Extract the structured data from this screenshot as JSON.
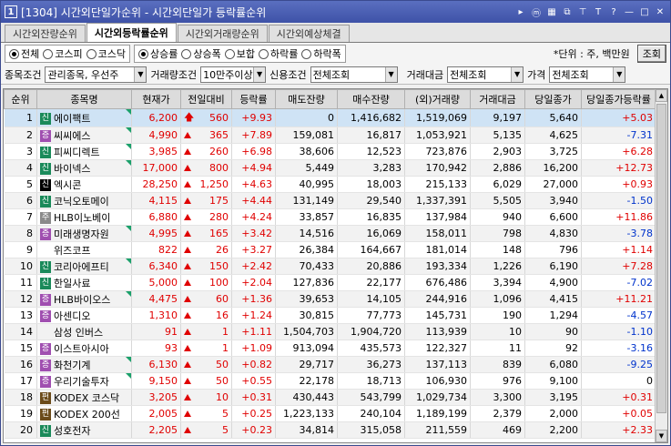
{
  "window": {
    "number": "1",
    "title": "[1304] 시간외단일가순위 - 시간외단일가 등락률순위"
  },
  "tabs": [
    {
      "label": "시간외잔량순위",
      "active": false
    },
    {
      "label": "시간외등락률순위",
      "active": true
    },
    {
      "label": "시간외거래량순위",
      "active": false
    },
    {
      "label": "시간외예상체결",
      "active": false
    }
  ],
  "market_filter": {
    "options": [
      "전체",
      "코스피",
      "코스닥"
    ],
    "selected": "전체"
  },
  "direction_filter": {
    "options": [
      "상승률",
      "상승폭",
      "보합",
      "하락률",
      "하락폭"
    ],
    "selected": "상승률"
  },
  "unit_text": "*단위 : 주, 백만원",
  "lookup_button": "조회",
  "conditions": {
    "item_label": "종목조건",
    "item_value": "관리종목, 우선주",
    "volume_label": "거래량조건",
    "volume_value": "10만주이상",
    "credit_label": "신용조건",
    "credit_value": "전체조회",
    "amount_label": "거래대금",
    "amount_value": "전체조회",
    "price_label": "가격",
    "price_value": "전체조회"
  },
  "table": {
    "headers": [
      "순위",
      "종목명",
      "현재가",
      "전일대비",
      "등락률",
      "매도잔량",
      "매수잔량",
      "(외)거래량",
      "거래대금",
      "당일종가",
      "당일종가등락률"
    ],
    "rows": [
      {
        "rank": "1",
        "badge": "신",
        "btype": "sin",
        "name": "에이팩트",
        "price": "6,200",
        "diff": "560",
        "marker": "arrow",
        "rate": "+9.93",
        "sell": "0",
        "buy": "1,416,682",
        "volume": "1,519,069",
        "amount": "9,197",
        "close": "5,640",
        "close_rate": "+5.03",
        "cr_dir": "up",
        "corner": true
      },
      {
        "rank": "2",
        "badge": "증",
        "btype": "jeung",
        "name": "씨씨에스",
        "price": "4,990",
        "diff": "365",
        "marker": "tri",
        "rate": "+7.89",
        "sell": "159,081",
        "buy": "16,817",
        "volume": "1,053,921",
        "amount": "5,135",
        "close": "4,625",
        "close_rate": "-7.31",
        "cr_dir": "down",
        "corner": true
      },
      {
        "rank": "3",
        "badge": "신",
        "btype": "sin",
        "name": "피씨디렉트",
        "price": "3,985",
        "diff": "260",
        "marker": "tri",
        "rate": "+6.98",
        "sell": "38,606",
        "buy": "12,523",
        "volume": "723,876",
        "amount": "2,903",
        "close": "3,725",
        "close_rate": "+6.28",
        "cr_dir": "up",
        "corner": true
      },
      {
        "rank": "4",
        "badge": "신",
        "btype": "sin",
        "name": "바이넥스",
        "price": "17,000",
        "diff": "800",
        "marker": "tri",
        "rate": "+4.94",
        "sell": "5,449",
        "buy": "3,283",
        "volume": "170,942",
        "amount": "2,886",
        "close": "16,200",
        "close_rate": "+12.73",
        "cr_dir": "up",
        "corner": true
      },
      {
        "rank": "5",
        "badge": "신",
        "btype": "sin-dark",
        "name": "엑시콘",
        "price": "28,250",
        "diff": "1,250",
        "marker": "tri",
        "rate": "+4.63",
        "sell": "40,995",
        "buy": "18,003",
        "volume": "215,133",
        "amount": "6,029",
        "close": "27,000",
        "close_rate": "+0.93",
        "cr_dir": "up",
        "corner": false
      },
      {
        "rank": "6",
        "badge": "신",
        "btype": "sin",
        "name": "코닉오토메이",
        "price": "4,115",
        "diff": "175",
        "marker": "tri",
        "rate": "+4.44",
        "sell": "131,149",
        "buy": "29,540",
        "volume": "1,337,391",
        "amount": "5,505",
        "close": "3,940",
        "close_rate": "-1.50",
        "cr_dir": "down",
        "corner": false
      },
      {
        "rank": "7",
        "badge": "주",
        "btype": "ju",
        "name": "HLB이노베이",
        "price": "6,880",
        "diff": "280",
        "marker": "tri",
        "rate": "+4.24",
        "sell": "33,857",
        "buy": "16,835",
        "volume": "137,984",
        "amount": "940",
        "close": "6,600",
        "close_rate": "+11.86",
        "cr_dir": "up",
        "corner": false
      },
      {
        "rank": "8",
        "badge": "증",
        "btype": "jeung",
        "name": "미래생명자원",
        "price": "4,995",
        "diff": "165",
        "marker": "tri",
        "rate": "+3.42",
        "sell": "14,516",
        "buy": "16,069",
        "volume": "158,011",
        "amount": "798",
        "close": "4,830",
        "close_rate": "-3.78",
        "cr_dir": "down",
        "corner": true
      },
      {
        "rank": "9",
        "badge": "",
        "btype": "",
        "name": "위즈코프",
        "price": "822",
        "diff": "26",
        "marker": "tri",
        "rate": "+3.27",
        "sell": "26,384",
        "buy": "164,667",
        "volume": "181,014",
        "amount": "148",
        "close": "796",
        "close_rate": "+1.14",
        "cr_dir": "up",
        "corner": false
      },
      {
        "rank": "10",
        "badge": "신",
        "btype": "sin",
        "name": "코리아에프티",
        "price": "6,340",
        "diff": "150",
        "marker": "tri",
        "rate": "+2.42",
        "sell": "70,433",
        "buy": "20,886",
        "volume": "193,334",
        "amount": "1,226",
        "close": "6,190",
        "close_rate": "+7.28",
        "cr_dir": "up",
        "corner": true
      },
      {
        "rank": "11",
        "badge": "신",
        "btype": "sin",
        "name": "한일사료",
        "price": "5,000",
        "diff": "100",
        "marker": "tri",
        "rate": "+2.04",
        "sell": "127,836",
        "buy": "22,177",
        "volume": "676,486",
        "amount": "3,394",
        "close": "4,900",
        "close_rate": "-7.02",
        "cr_dir": "down",
        "corner": false
      },
      {
        "rank": "12",
        "badge": "증",
        "btype": "jeung",
        "name": "HLB바이오스",
        "price": "4,475",
        "diff": "60",
        "marker": "tri",
        "rate": "+1.36",
        "sell": "39,653",
        "buy": "14,105",
        "volume": "244,916",
        "amount": "1,096",
        "close": "4,415",
        "close_rate": "+11.21",
        "cr_dir": "up",
        "corner": true
      },
      {
        "rank": "13",
        "badge": "증",
        "btype": "jeung",
        "name": "아센디오",
        "price": "1,310",
        "diff": "16",
        "marker": "tri",
        "rate": "+1.24",
        "sell": "30,815",
        "buy": "77,773",
        "volume": "145,731",
        "amount": "190",
        "close": "1,294",
        "close_rate": "-4.57",
        "cr_dir": "down",
        "corner": false
      },
      {
        "rank": "14",
        "badge": "",
        "btype": "",
        "name": "삼성 인버스",
        "price": "91",
        "diff": "1",
        "marker": "tri",
        "rate": "+1.11",
        "sell": "1,504,703",
        "buy": "1,904,720",
        "volume": "113,939",
        "amount": "10",
        "close": "90",
        "close_rate": "-1.10",
        "cr_dir": "down",
        "corner": false
      },
      {
        "rank": "15",
        "badge": "증",
        "btype": "jeung",
        "name": "이스트아시아",
        "price": "93",
        "diff": "1",
        "marker": "tri",
        "rate": "+1.09",
        "sell": "913,094",
        "buy": "435,573",
        "volume": "122,327",
        "amount": "11",
        "close": "92",
        "close_rate": "-3.16",
        "cr_dir": "down",
        "corner": false
      },
      {
        "rank": "16",
        "badge": "증",
        "btype": "jeung",
        "name": "화천기계",
        "price": "6,130",
        "diff": "50",
        "marker": "tri",
        "rate": "+0.82",
        "sell": "29,717",
        "buy": "36,273",
        "volume": "137,113",
        "amount": "839",
        "close": "6,080",
        "close_rate": "-9.25",
        "cr_dir": "down",
        "corner": true
      },
      {
        "rank": "17",
        "badge": "증",
        "btype": "jeung",
        "name": "우리기술투자",
        "price": "9,150",
        "diff": "50",
        "marker": "tri",
        "rate": "+0.55",
        "sell": "22,178",
        "buy": "18,713",
        "volume": "106,930",
        "amount": "976",
        "close": "9,100",
        "close_rate": "0",
        "cr_dir": "none",
        "corner": true
      },
      {
        "rank": "18",
        "badge": "펀",
        "btype": "peon",
        "name": "KODEX 코스닥",
        "price": "3,205",
        "diff": "10",
        "marker": "tri",
        "rate": "+0.31",
        "sell": "430,443",
        "buy": "543,799",
        "volume": "1,029,734",
        "amount": "3,300",
        "close": "3,195",
        "close_rate": "+0.31",
        "cr_dir": "up",
        "corner": false
      },
      {
        "rank": "19",
        "badge": "펀",
        "btype": "peon",
        "name": "KODEX 200선",
        "price": "2,005",
        "diff": "5",
        "marker": "tri",
        "rate": "+0.25",
        "sell": "1,223,133",
        "buy": "240,104",
        "volume": "1,189,199",
        "amount": "2,379",
        "close": "2,000",
        "close_rate": "+0.05",
        "cr_dir": "up",
        "corner": false
      },
      {
        "rank": "20",
        "badge": "신",
        "btype": "sin",
        "name": "성호전자",
        "price": "2,205",
        "diff": "5",
        "marker": "tri",
        "rate": "+0.23",
        "sell": "34,814",
        "buy": "315,058",
        "volume": "211,559",
        "amount": "469",
        "close": "2,200",
        "close_rate": "+2.33",
        "cr_dir": "up",
        "corner": false
      }
    ]
  },
  "colors": {
    "up": "#e00000",
    "down": "#0033cc",
    "selected_row": "#cfe3f5"
  }
}
